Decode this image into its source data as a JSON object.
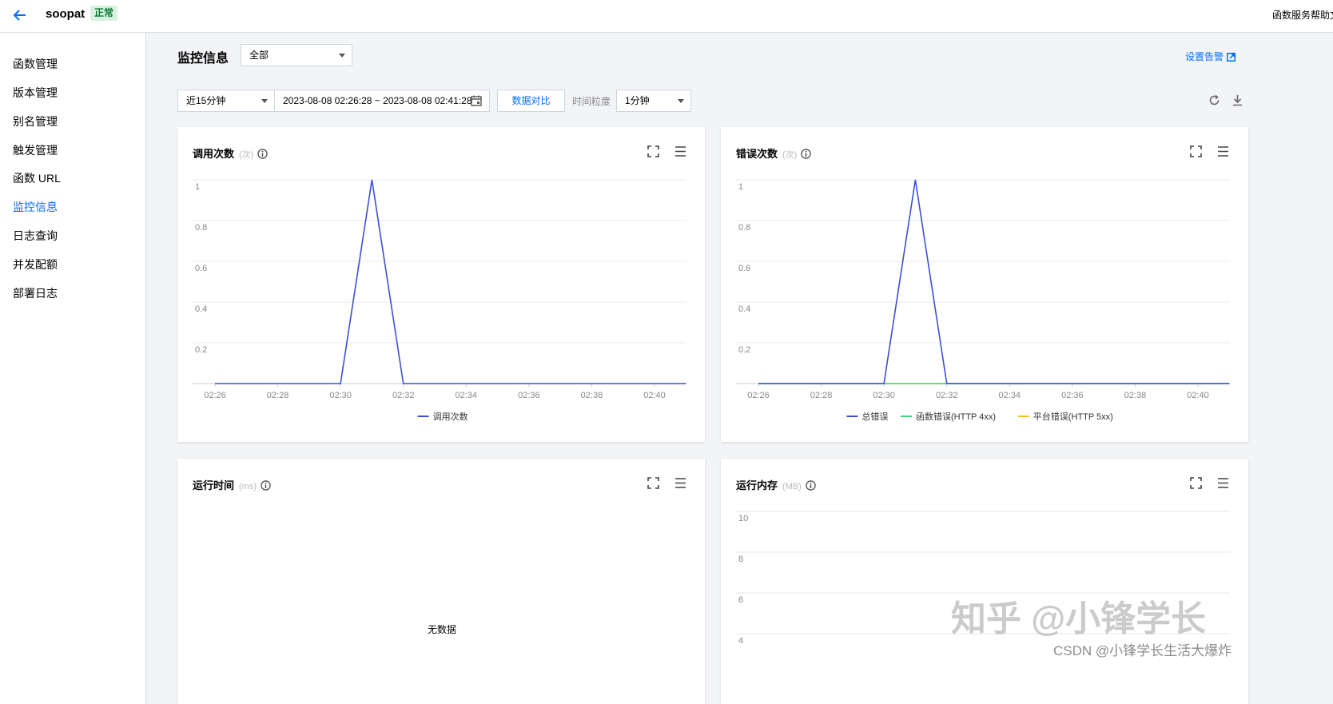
{
  "header": {
    "function_name": "soopat",
    "status": "正常",
    "help_link": "函数服务帮助文档"
  },
  "sidebar": {
    "items": [
      {
        "label": "函数管理"
      },
      {
        "label": "版本管理"
      },
      {
        "label": "别名管理"
      },
      {
        "label": "触发管理"
      },
      {
        "label": "函数 URL"
      },
      {
        "label": "监控信息",
        "active": true
      },
      {
        "label": "日志查询"
      },
      {
        "label": "并发配额"
      },
      {
        "label": "部署日志"
      }
    ]
  },
  "main": {
    "title": "监控信息",
    "scope_select": "全部",
    "alarm_link": "设置告警",
    "time_range_select": "近15分钟",
    "date_range": "2023-08-08 02:26:28 ~ 2023-08-08 02:41:28",
    "compare_button": "数据对比",
    "granularity_label": "时间粒度",
    "granularity_select": "1分钟"
  },
  "colors": {
    "accent": "#006eff",
    "series_blue": "#3b50d6",
    "series_green": "#4ccf7a",
    "series_yellow": "#f2c12e"
  },
  "cards": [
    {
      "title": "调用次数",
      "unit": "(次)"
    },
    {
      "title": "错误次数",
      "unit": "(次)"
    },
    {
      "title": "运行时间",
      "unit": "(ms)",
      "empty_text": "无数据"
    },
    {
      "title": "运行内存",
      "unit": "(MB)"
    }
  ],
  "chart_data": [
    {
      "type": "line",
      "title": "调用次数",
      "x": [
        "02:26",
        "02:27",
        "02:28",
        "02:29",
        "02:30",
        "02:31",
        "02:32",
        "02:33",
        "02:34",
        "02:35",
        "02:36",
        "02:37",
        "02:38",
        "02:39",
        "02:40",
        "02:41"
      ],
      "x_ticks": [
        "02:26",
        "02:28",
        "02:30",
        "02:32",
        "02:34",
        "02:36",
        "02:38",
        "02:40"
      ],
      "y_ticks": [
        "1",
        "0.8",
        "0.6",
        "0.4",
        "0.2"
      ],
      "ylim": [
        0,
        1
      ],
      "series": [
        {
          "name": "调用次数",
          "color": "#3b50d6",
          "values": [
            0,
            0,
            0,
            0,
            0,
            1,
            0,
            0,
            0,
            0,
            0,
            0,
            0,
            0,
            0,
            0
          ]
        }
      ],
      "grid": true,
      "legend": "bottom-center"
    },
    {
      "type": "line",
      "title": "错误次数",
      "x": [
        "02:26",
        "02:27",
        "02:28",
        "02:29",
        "02:30",
        "02:31",
        "02:32",
        "02:33",
        "02:34",
        "02:35",
        "02:36",
        "02:37",
        "02:38",
        "02:39",
        "02:40",
        "02:41"
      ],
      "x_ticks": [
        "02:26",
        "02:28",
        "02:30",
        "02:32",
        "02:34",
        "02:36",
        "02:38",
        "02:40"
      ],
      "y_ticks": [
        "1",
        "0.8",
        "0.6",
        "0.4",
        "0.2"
      ],
      "ylim": [
        0,
        1
      ],
      "series": [
        {
          "name": "总错误",
          "color": "#3b50d6",
          "values": [
            0,
            0,
            0,
            0,
            0,
            1,
            0,
            0,
            0,
            0,
            0,
            0,
            0,
            0,
            0,
            0
          ]
        },
        {
          "name": "函数错误(HTTP 4xx)",
          "color": "#4ccf7a",
          "values": [
            0,
            0,
            0,
            0,
            0,
            0,
            0,
            0,
            0,
            0,
            0,
            0,
            0,
            0,
            0,
            0
          ]
        },
        {
          "name": "平台错误(HTTP 5xx)",
          "color": "#f2c12e",
          "values": [
            0,
            0,
            0,
            0,
            0,
            0,
            0,
            0,
            0,
            0,
            0,
            0,
            0,
            0,
            0,
            0
          ]
        }
      ],
      "grid": true,
      "legend": "bottom-center"
    },
    {
      "type": "line",
      "title": "运行内存",
      "y_ticks": [
        "10",
        "8",
        "6",
        "4"
      ],
      "series": [],
      "grid": true
    }
  ],
  "watermarks": {
    "zhihu": "知乎 @小锋学长",
    "csdn": "CSDN @小锋学长生活大爆炸"
  }
}
